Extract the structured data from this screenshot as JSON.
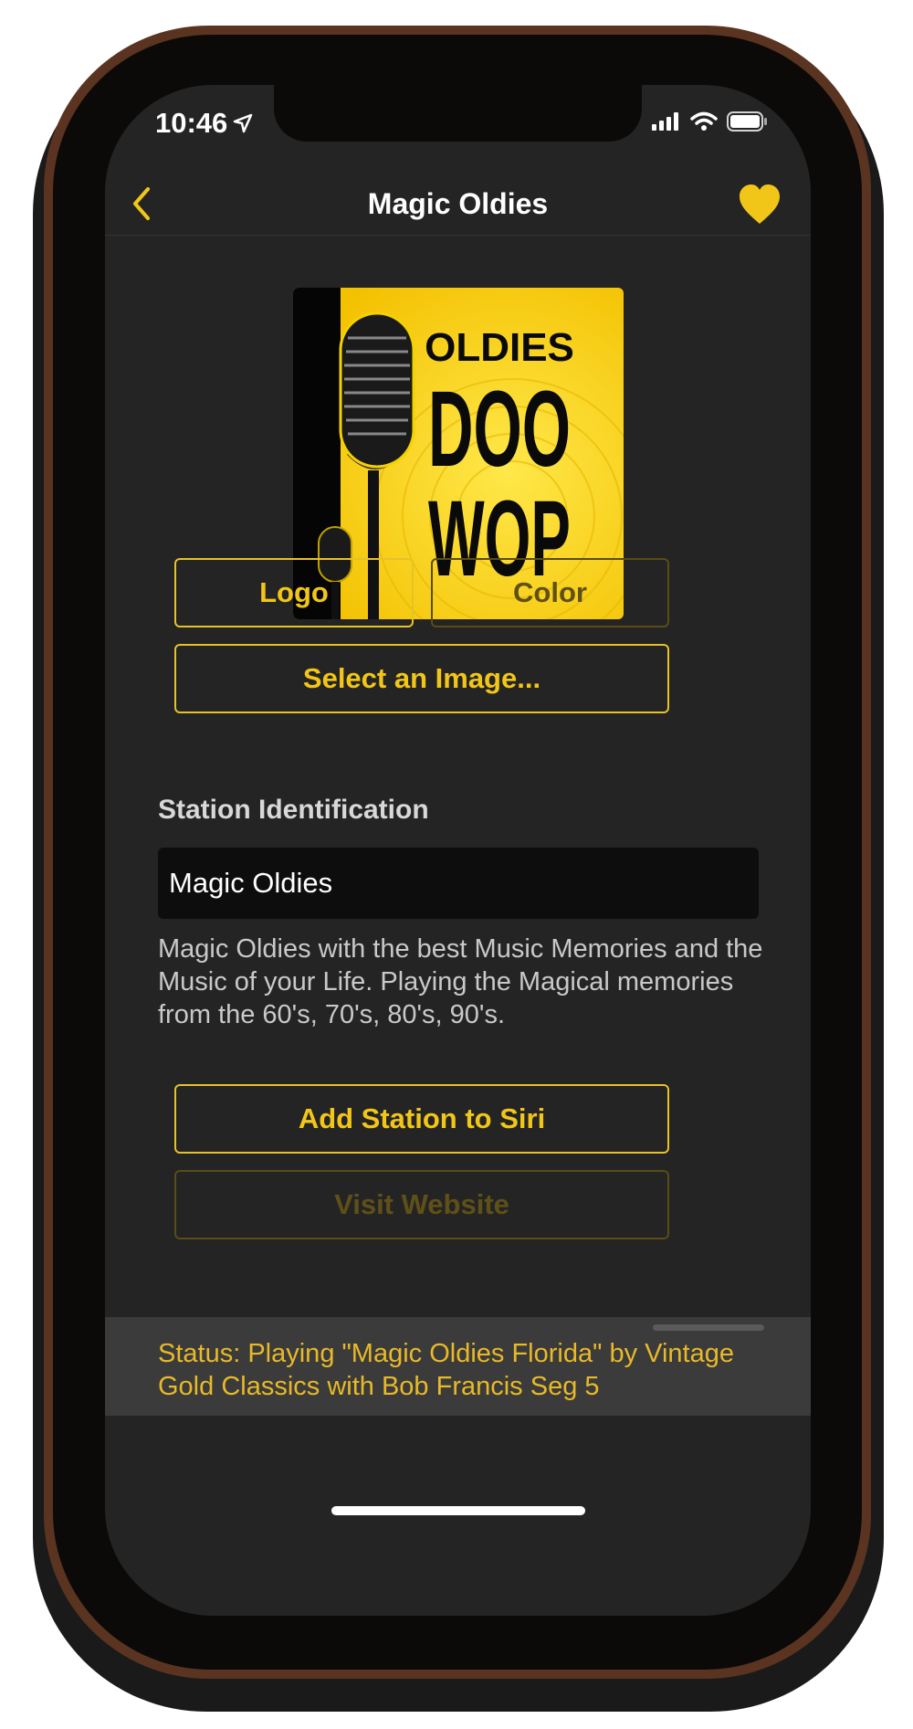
{
  "status_bar": {
    "time": "10:46"
  },
  "nav": {
    "title": "Magic Oldies"
  },
  "artwork": {
    "line1": "OLDIES",
    "line2": "DOO",
    "line3": "WOP"
  },
  "image_source": {
    "logo_label": "Logo",
    "color_label": "Color",
    "select_image_label": "Select an Image..."
  },
  "station": {
    "section_label": "Station Identification",
    "name_value": "Magic Oldies",
    "description": "Magic Oldies with the best Music Memories and the Music of your Life. Playing the Magical memories from the 60's, 70's, 80's, 90's."
  },
  "actions": {
    "siri_label": "Add Station to Siri",
    "website_label": "Visit Website"
  },
  "playback_status": {
    "text": "Status: Playing \"Magic Oldies Florida\" by Vintage Gold Classics with Bob Francis Seg 5"
  },
  "colors": {
    "accent": "#f2c618",
    "background": "#242424",
    "status_background": "#3b3b3b"
  },
  "icons": [
    "back-chevron-icon",
    "heart-icon",
    "location-arrow-icon",
    "signal-icon",
    "wifi-icon",
    "battery-icon",
    "microphone-icon"
  ]
}
